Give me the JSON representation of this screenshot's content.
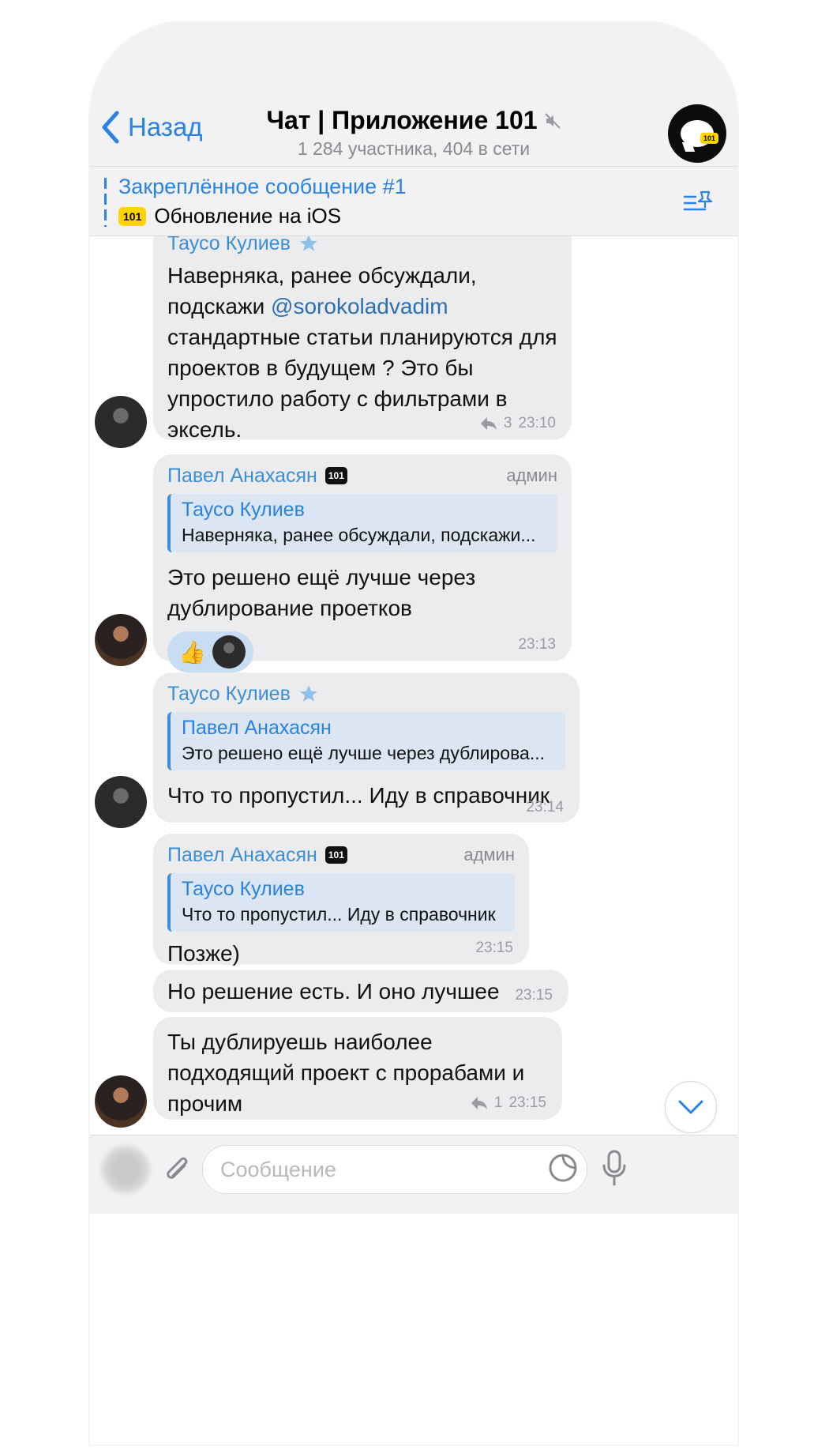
{
  "header": {
    "back_label": "Назад",
    "title": "Чат | Приложение 101",
    "subtitle": "1 284 участника, 404 в сети",
    "avatar_tag": "101"
  },
  "pinned": {
    "title": "Закреплённое сообщение #1",
    "badge": "101",
    "text": "Обновление на iOS"
  },
  "messages": [
    {
      "sender": "Таусо Кулиев",
      "text_part1": "Наверняка, ранее обсуждали, подскажи ",
      "mention": "@sorokoladvadim",
      "text_part2": " стандартные статьи планируются для проектов в будущем ? Это бы упростило работу с фильтрами в эксель.",
      "replies": "3",
      "time": "23:10"
    },
    {
      "sender": "Павел Анахасян",
      "badge": "101",
      "role": "админ",
      "quote_name": "Таусо Кулиев",
      "quote_text": "Наверняка, ранее обсуждали, подскажи...",
      "text": "Это решено ещё лучше через дублирование проетков",
      "reaction_emoji": "👍",
      "time": "23:13"
    },
    {
      "sender": "Таусо Кулиев",
      "quote_name": "Павел Анахасян",
      "quote_text": "Это решено ещё лучше через дублирова...",
      "text": "Что то пропустил... Иду в справочник",
      "time": "23:14"
    },
    {
      "sender": "Павел Анахасян",
      "badge": "101",
      "role": "админ",
      "quote_name": "Таусо Кулиев",
      "quote_text": "Что то пропустил... Иду в справочник",
      "text": "Позже)",
      "time": "23:15"
    },
    {
      "text": "Но решение есть. И оно лучшее",
      "time": "23:15"
    },
    {
      "text": "Ты дублируешь наиболее подходящий проект с прорабами и прочим",
      "replies": "1",
      "time": "23:15"
    }
  ],
  "composer": {
    "placeholder": "Сообщение"
  },
  "colors": {
    "accent": "#2a82e4",
    "bubble": "#ececef",
    "quote_bg": "#dbe6f2",
    "badge_yellow": "#ffd400"
  }
}
